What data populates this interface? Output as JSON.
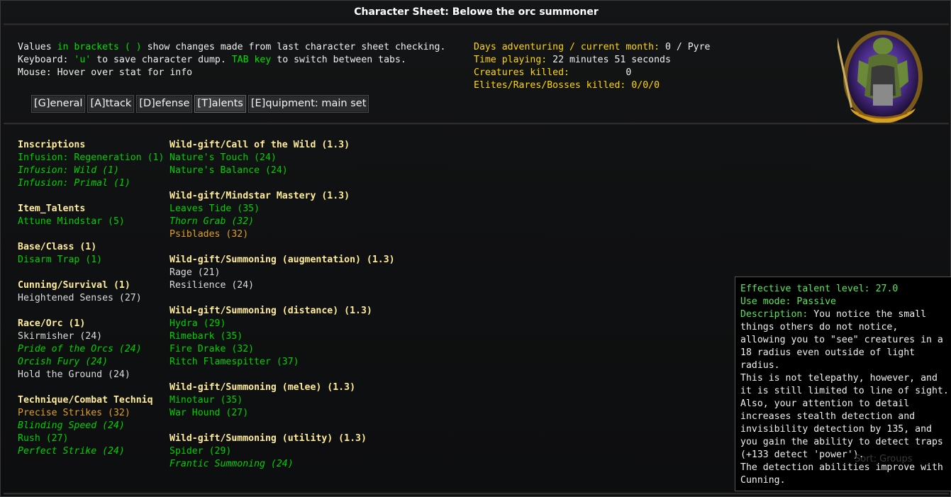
{
  "window": {
    "title": "Character Sheet: Belowe the orc summoner"
  },
  "help": {
    "line1": {
      "a": "Values ",
      "b": "in brackets ( )",
      "c": " show changes made from last character sheet checking."
    },
    "line2": {
      "a": "Keyboard: ",
      "b": "'u'",
      "c": " to save character dump. ",
      "d": "TAB key",
      "e": " to switch between tabs."
    },
    "line3": "Mouse: Hover over stat for info"
  },
  "stats": {
    "days_label": "Days adventuring / current month:",
    "days_value": " 0 / Pyre",
    "time_label": "Time playing:",
    "time_value": " 22 minutes 51 seconds",
    "killed_label": "Creatures killed:",
    "killed_value": "          0",
    "elites_label": "Elites/Rares/Bosses killed:",
    "elites_value": " 0/0/0"
  },
  "tabs": [
    {
      "label": "[G]eneral"
    },
    {
      "label": "[A]ttack"
    },
    {
      "label": "[D]efense"
    },
    {
      "label": "[T]alents"
    },
    {
      "label": "[E]quipment: main set"
    }
  ],
  "left_column": {
    "inscriptions": {
      "title": "Inscriptions",
      "items": [
        "Infusion: Regeneration (1)",
        "Infusion: Wild (1)",
        "Infusion: Primal (1)"
      ]
    },
    "item_talents": {
      "title": "Item_Talents",
      "items": [
        "Attune Mindstar (5)"
      ]
    },
    "base_class": {
      "title": "Base/Class (1)",
      "items": [
        "Disarm Trap (1)"
      ]
    },
    "cunning": {
      "title": "Cunning/Survival (1)",
      "items": [
        "Heightened Senses (27)"
      ]
    },
    "race": {
      "title": "Race/Orc (1)",
      "items": [
        "Skirmisher (24)",
        "Pride of the Orcs (24)",
        "Orcish Fury (24)",
        "Hold the Ground (24)"
      ]
    },
    "technique": {
      "title": "Technique/Combat Techniq",
      "items": [
        "Precise Strikes (32)",
        "Blinding Speed (24)",
        "Rush (27)",
        "Perfect Strike (24)"
      ]
    }
  },
  "right_column": {
    "call_wild": {
      "title": "Wild-gift/Call of the Wild (1.3)",
      "items": [
        "Nature's Touch (24)",
        "Nature's Balance (24)"
      ]
    },
    "mindstar": {
      "title": "Wild-gift/Mindstar Mastery (1.3)",
      "items": [
        "Leaves Tide (35)",
        "Thorn Grab (32)",
        "Psiblades (32)"
      ]
    },
    "augment": {
      "title": "Wild-gift/Summoning (augmentation) (1.3)",
      "items": [
        "Rage (21)",
        "Resilience (24)"
      ]
    },
    "distance": {
      "title": "Wild-gift/Summoning (distance) (1.3)",
      "items": [
        "Hydra (29)",
        "Rimebark (35)",
        "Fire Drake (32)",
        "Ritch Flamespitter (37)"
      ]
    },
    "melee": {
      "title": "Wild-gift/Summoning (melee) (1.3)",
      "items": [
        "Minotaur (35)",
        "War Hound (27)"
      ]
    },
    "utility": {
      "title": "Wild-gift/Summoning (utility) (1.3)",
      "items": [
        "Spider (29)",
        "Frantic Summoning (24)"
      ]
    }
  },
  "tooltip": {
    "level_label": "Effective talent level:",
    "level_value": " 27.0",
    "mode_label": "Use mode:",
    "mode_value": " Passive",
    "desc_label": "Description:",
    "desc_first": " You notice the small",
    "desc_lines": [
      "things others do not notice,",
      "allowing you to \"see\" creatures in a",
      "18 radius even outside of light",
      "radius.",
      "This is not telepathy, however, and",
      "it is still limited to line of sight.",
      "Also, your attention to detail",
      "increases stealth detection and",
      "invisibility detection by 135, and",
      "you gain the ability to detect traps",
      "(+133 detect 'power').",
      "The detection abilities improve with",
      "Cunning."
    ]
  },
  "sort_button": "Sort: Groups",
  "colors": {
    "green": "#00d000",
    "gold": "#e0a020",
    "yellow": "#ffd700",
    "category": "#ffec9a"
  }
}
